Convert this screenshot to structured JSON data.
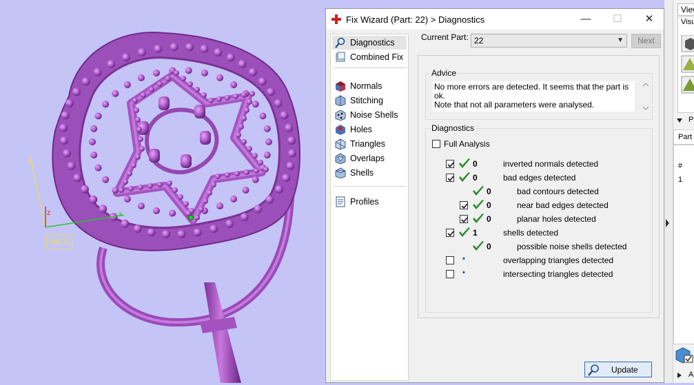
{
  "viewport": {
    "wcs_label": "WCS",
    "axis_z_label": "z",
    "axis_y_label": "y",
    "axis_x_label": "x"
  },
  "dialog": {
    "title": "Fix Wizard (Part: 22) > Diagnostics",
    "minimize_glyph": "—",
    "maximize_glyph": "☐",
    "close_glyph": "✕",
    "nav": [
      {
        "label": "Diagnostics",
        "icon": "magnifier-icon",
        "selected": true
      },
      {
        "label": "Combined Fix",
        "icon": "combined-fix-icon"
      },
      {
        "label": "Normals",
        "icon": "normals-icon"
      },
      {
        "label": "Stitching",
        "icon": "stitching-icon"
      },
      {
        "label": "Noise Shells",
        "icon": "noise-shells-icon"
      },
      {
        "label": "Holes",
        "icon": "holes-icon"
      },
      {
        "label": "Triangles",
        "icon": "triangles-icon"
      },
      {
        "label": "Overlaps",
        "icon": "overlaps-icon"
      },
      {
        "label": "Shells",
        "icon": "shells-icon"
      },
      {
        "label": "Profiles",
        "icon": "profiles-icon"
      }
    ],
    "current_part_label": "Current Part:",
    "current_part_value": "22",
    "next_label": "Next",
    "advice": {
      "heading": "Advice",
      "text_line1": "No more errors are detected. It seems that the part is ok.",
      "text_line2": "Note that not all parameters were analysed."
    },
    "diagnostics": {
      "heading": "Diagnostics",
      "full_analysis_label": "Full Analysis",
      "full_analysis_checked": false,
      "rows": [
        {
          "label": "inverted normals detected",
          "value": "0",
          "checked": true,
          "status": "ok",
          "indent": 0
        },
        {
          "label": "bad edges detected",
          "value": "0",
          "checked": true,
          "status": "ok",
          "indent": 0
        },
        {
          "label": "bad contours detected",
          "value": "0",
          "checked": null,
          "status": "ok",
          "indent": 1
        },
        {
          "label": "near bad edges detected",
          "value": "0",
          "checked": true,
          "status": "ok",
          "indent": 1
        },
        {
          "label": "planar holes detected",
          "value": "0",
          "checked": true,
          "status": "ok",
          "indent": 1
        },
        {
          "label": "shells detected",
          "value": "1",
          "checked": true,
          "status": "ok",
          "indent": 0
        },
        {
          "label": "possible noise shells detected",
          "value": "0",
          "checked": null,
          "status": "ok",
          "indent": 1
        },
        {
          "label": "overlapping triangles detected",
          "value": "",
          "checked": false,
          "status": "pending",
          "indent": 0
        },
        {
          "label": "intersecting triangles detected",
          "value": "",
          "checked": false,
          "status": "pending",
          "indent": 0
        }
      ],
      "update_label": "Update"
    }
  },
  "right_panel": {
    "tab_view": "View",
    "visual_label": "Visu",
    "parts_label": "Pa",
    "part_tab": "Part",
    "col_hash": "#",
    "row_1": "1",
    "bottom_label": "A"
  },
  "colors": {
    "viewport_bg": "#c4c4f6",
    "model": "#b060c8",
    "check": "#2a8a2a",
    "accent": "#2f6fb7"
  }
}
